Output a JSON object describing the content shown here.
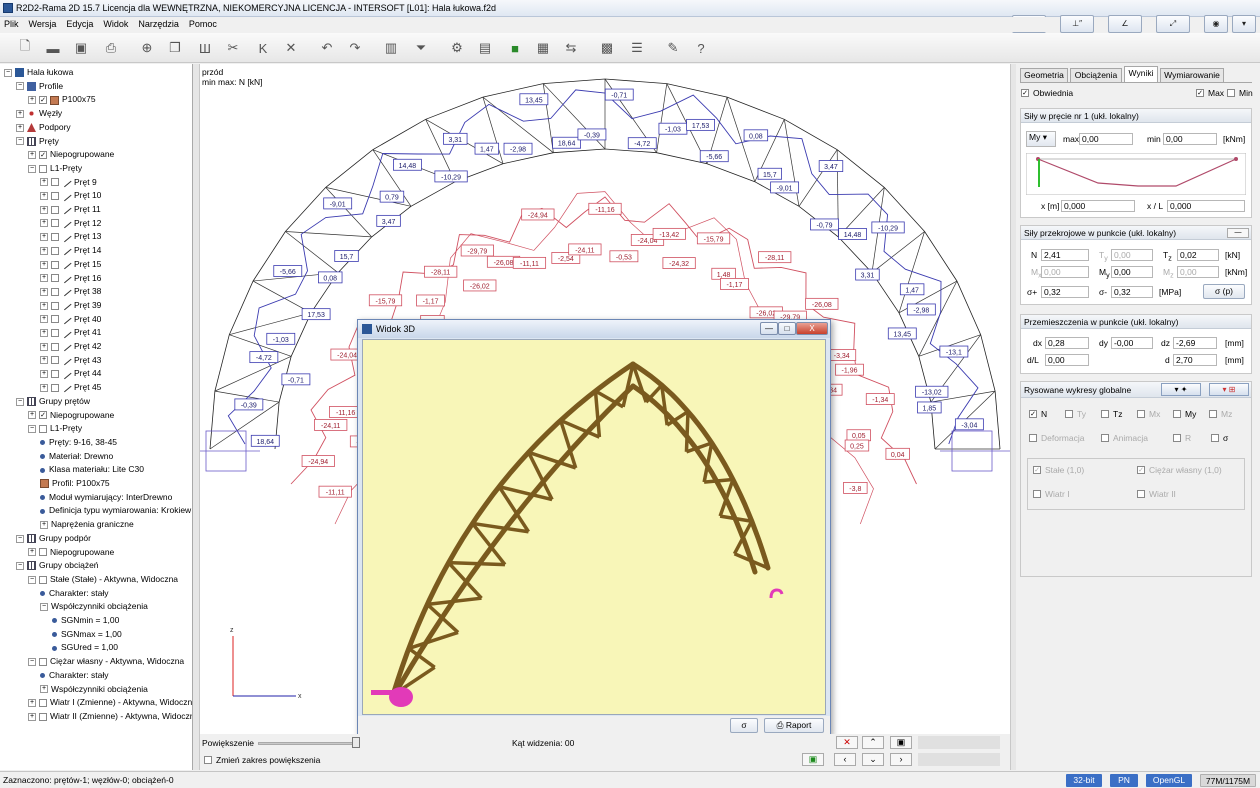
{
  "window": {
    "title": "R2D2-Rama 2D 15.7 Licencja dla WEWNĘTRZNA, NIEKOMERCYJNA LICENCJA - INTERSOFT [L01]: Hala łukowa.f2d"
  },
  "menu": [
    "Plik",
    "Wersja",
    "Edycja",
    "Widok",
    "Narzędzia",
    "Pomoc"
  ],
  "tree": {
    "rows": [
      {
        "text": "Hala łukowa",
        "indent": 0,
        "exp": "-",
        "icon": "model"
      },
      {
        "text": "Profile",
        "indent": 1,
        "exp": "-",
        "icon": "profile"
      },
      {
        "text": "P100x75",
        "indent": 2,
        "exp": "+",
        "chk": "✓",
        "icon": "swatch"
      },
      {
        "text": "Węzły",
        "indent": 1,
        "exp": "+",
        "icon": "nodes"
      },
      {
        "text": "Podpory",
        "indent": 1,
        "exp": "+",
        "icon": "support"
      },
      {
        "text": "Pręty",
        "indent": 1,
        "exp": "-",
        "icon": "bars"
      },
      {
        "text": "Niepogrupowane",
        "indent": 2,
        "exp": "+",
        "chk": "✓"
      },
      {
        "text": "L1-Pręty",
        "indent": 2,
        "exp": "-",
        "chk": ""
      },
      {
        "text": "Pręt 9",
        "indent": 3,
        "exp": "+",
        "chk": "",
        "icon": "line"
      },
      {
        "text": "Pręt 10",
        "indent": 3,
        "exp": "+",
        "chk": "",
        "icon": "line"
      },
      {
        "text": "Pręt 11",
        "indent": 3,
        "exp": "+",
        "chk": "",
        "icon": "line"
      },
      {
        "text": "Pręt 12",
        "indent": 3,
        "exp": "+",
        "chk": "",
        "icon": "line"
      },
      {
        "text": "Pręt 13",
        "indent": 3,
        "exp": "+",
        "chk": "",
        "icon": "line"
      },
      {
        "text": "Pręt 14",
        "indent": 3,
        "exp": "+",
        "chk": "",
        "icon": "line"
      },
      {
        "text": "Pręt 15",
        "indent": 3,
        "exp": "+",
        "chk": "",
        "icon": "line"
      },
      {
        "text": "Pręt 16",
        "indent": 3,
        "exp": "+",
        "chk": "",
        "icon": "line"
      },
      {
        "text": "Pręt 38",
        "indent": 3,
        "exp": "+",
        "chk": "",
        "icon": "line"
      },
      {
        "text": "Pręt 39",
        "indent": 3,
        "exp": "+",
        "chk": "",
        "icon": "line"
      },
      {
        "text": "Pręt 40",
        "indent": 3,
        "exp": "+",
        "chk": "",
        "icon": "line"
      },
      {
        "text": "Pręt 41",
        "indent": 3,
        "exp": "+",
        "chk": "",
        "icon": "line"
      },
      {
        "text": "Pręt 42",
        "indent": 3,
        "exp": "+",
        "chk": "",
        "icon": "line"
      },
      {
        "text": "Pręt 43",
        "indent": 3,
        "exp": "+",
        "chk": "",
        "icon": "line"
      },
      {
        "text": "Pręt 44",
        "indent": 3,
        "exp": "+",
        "chk": "",
        "icon": "line"
      },
      {
        "text": "Pręt 45",
        "indent": 3,
        "exp": "+",
        "chk": "",
        "icon": "line"
      },
      {
        "text": "Grupy prętów",
        "indent": 1,
        "exp": "-",
        "icon": "bars"
      },
      {
        "text": "Niepogrupowane",
        "indent": 2,
        "exp": "+",
        "chk": "✓"
      },
      {
        "text": "L1-Pręty",
        "indent": 2,
        "exp": "-",
        "chk": ""
      },
      {
        "text": "Pręty: 9-16, 38-45",
        "indent": 3,
        "dot": true
      },
      {
        "text": "Materiał: Drewno",
        "indent": 3,
        "dot": true
      },
      {
        "text": "Klasa materiału: Lite C30",
        "indent": 3,
        "dot": true
      },
      {
        "text": "Profil: P100x75",
        "indent": 3,
        "icon": "swatch"
      },
      {
        "text": "Moduł wymiarujący: InterDrewno",
        "indent": 3,
        "dot": true
      },
      {
        "text": "Definicja typu wymiarowania: Krokiew",
        "indent": 3,
        "dot": true
      },
      {
        "text": "Naprężenia graniczne",
        "indent": 3,
        "exp": "+"
      },
      {
        "text": "Grupy podpór",
        "indent": 1,
        "exp": "-",
        "icon": "bars"
      },
      {
        "text": "Niepogrupowane",
        "indent": 2,
        "exp": "+",
        "chk": ""
      },
      {
        "text": "Grupy obciążeń",
        "indent": 1,
        "exp": "-",
        "icon": "bars"
      },
      {
        "text": "Stałe (Stałe) - Aktywna, Widoczna",
        "indent": 2,
        "exp": "-",
        "chk": ""
      },
      {
        "text": "Charakter: stały",
        "indent": 3,
        "dot": true
      },
      {
        "text": "Współczynniki obciążenia",
        "indent": 3,
        "exp": "-"
      },
      {
        "text": "SGNmin = 1,00",
        "indent": 4,
        "dot": true
      },
      {
        "text": "SGNmax = 1,00",
        "indent": 4,
        "dot": true
      },
      {
        "text": "SGUred = 1,00",
        "indent": 4,
        "dot": true
      },
      {
        "text": "Ciężar własny - Aktywna, Widoczna",
        "indent": 2,
        "exp": "-",
        "chk": ""
      },
      {
        "text": "Charakter: stały",
        "indent": 3,
        "dot": true
      },
      {
        "text": "Współczynniki obciążenia",
        "indent": 3,
        "exp": "+"
      },
      {
        "text": "Wiatr I (Zmienne) - Aktywna, Widoczna",
        "indent": 2,
        "exp": "+",
        "chk": ""
      },
      {
        "text": "Wiatr II (Zmienne) - Aktywna, Widoczna",
        "indent": 2,
        "exp": "+",
        "chk": ""
      }
    ]
  },
  "view": {
    "name": "przód",
    "subtitle": "min max: N [kN]"
  },
  "diagram_labels": {
    "blue": [
      "18,64",
      "-0,39",
      "-0,71",
      "-4,72",
      "-1,03",
      "17,53",
      "-5,66",
      "0,08",
      "15,7",
      "-9,01",
      "3,47",
      "0,79",
      "14,48",
      "-10,29",
      "3,31",
      "1,47",
      "-2,98",
      "13,45",
      "18,64",
      "-0,39",
      "-0,71",
      "-4,72",
      "-1,03",
      "17,53",
      "-5,66",
      "0,08",
      "15,7",
      "-9,01",
      "3,47",
      "-0,79",
      "14,48",
      "-10,29",
      "3,31",
      "1,47",
      "-2,98",
      "13,45",
      "-13,1",
      "-13,02",
      "1,85",
      "-3,04"
    ],
    "red": [
      "-11,11",
      "-24,94",
      "-2,54",
      "-24,11",
      "-11,16",
      "-0,53",
      "-24,04",
      "-13,42",
      "-24,32",
      "-15,79",
      "1,48",
      "-1,17",
      "-28,11",
      "-26,02",
      "-29,79",
      "-26,08",
      "-11,11",
      "-24,94",
      "-2,54",
      "-24,11",
      "-11,16",
      "-0,53",
      "-24,04",
      "-13,42",
      "-24,32",
      "-15,79",
      "1,48",
      "-1,17",
      "-28,11",
      "-26,02",
      "-29,79",
      "-26,08",
      "-26,77",
      "-3,34",
      "-1,96",
      "1,34",
      "-1,34",
      "0,05",
      "0,25",
      "0,04",
      "-3,8"
    ]
  },
  "win3d": {
    "title": "Widok 3D",
    "btn_sigma": "σ",
    "btn_report": "Raport",
    "min": "—",
    "max": "□",
    "close": "X"
  },
  "zoom": {
    "label": "Powiększenie",
    "angle": "Kąt widzenia: 00",
    "range_label": "Zmień zakres powiększenia"
  },
  "right": {
    "tabs": [
      "Geometria",
      "Obciążenia",
      "Wyniki",
      "Wymiarowanie"
    ],
    "envelope": "Obwiednia",
    "max": "Max",
    "min": "Min",
    "forces_head": "Siły w pręcie nr 1 (ukł. lokalny)",
    "force_sel": "My",
    "max_label": "max",
    "max_val": "0,00",
    "min_label": "min",
    "min_val": "0,00",
    "unit_knm": "[kNm]",
    "x_label": "x [m]",
    "x_val": "0,000",
    "xl_label": "x / L",
    "xl_val": "0,000",
    "sect_head": "Siły przekrojowe w punkcie (ukł. lokalny)",
    "sect": {
      "N": "2,41",
      "Ty": "0,00",
      "Tz": "0,02",
      "Mx": "0,00",
      "My": "0,00",
      "Mz": "0,00",
      "sp": "0,32",
      "sm": "0,32"
    },
    "unit_kn": "[kN]",
    "unit_mpa": "[MPa]",
    "sigma_btn": "σ (p)",
    "disp_head": "Przemieszczenia w punkcie (ukł. lokalny)",
    "disp": {
      "dx": "0,28",
      "dy": "-0,00",
      "dz": "-2,69",
      "dl": "0,00",
      "d": "2,70"
    },
    "unit_mm": "[mm]",
    "global_head": "Rysowane wykresy globalne",
    "g_opts": [
      "N",
      "Ty",
      "Tz",
      "Mx",
      "My",
      "Mz"
    ],
    "g_opts2": [
      "Deformacja",
      "Animacja",
      "R",
      "σ"
    ],
    "g_loads": [
      "Stałe (1,0)",
      "Ciężar własny (1,0)",
      "Wiatr I",
      "Wiatr II"
    ]
  },
  "status": {
    "text": "Zaznaczono: prętów-1; węzłów-0; obciążeń-0",
    "bit": "32-bit",
    "pn": "PN",
    "gl": "OpenGL",
    "mem": "77M/1175M"
  }
}
